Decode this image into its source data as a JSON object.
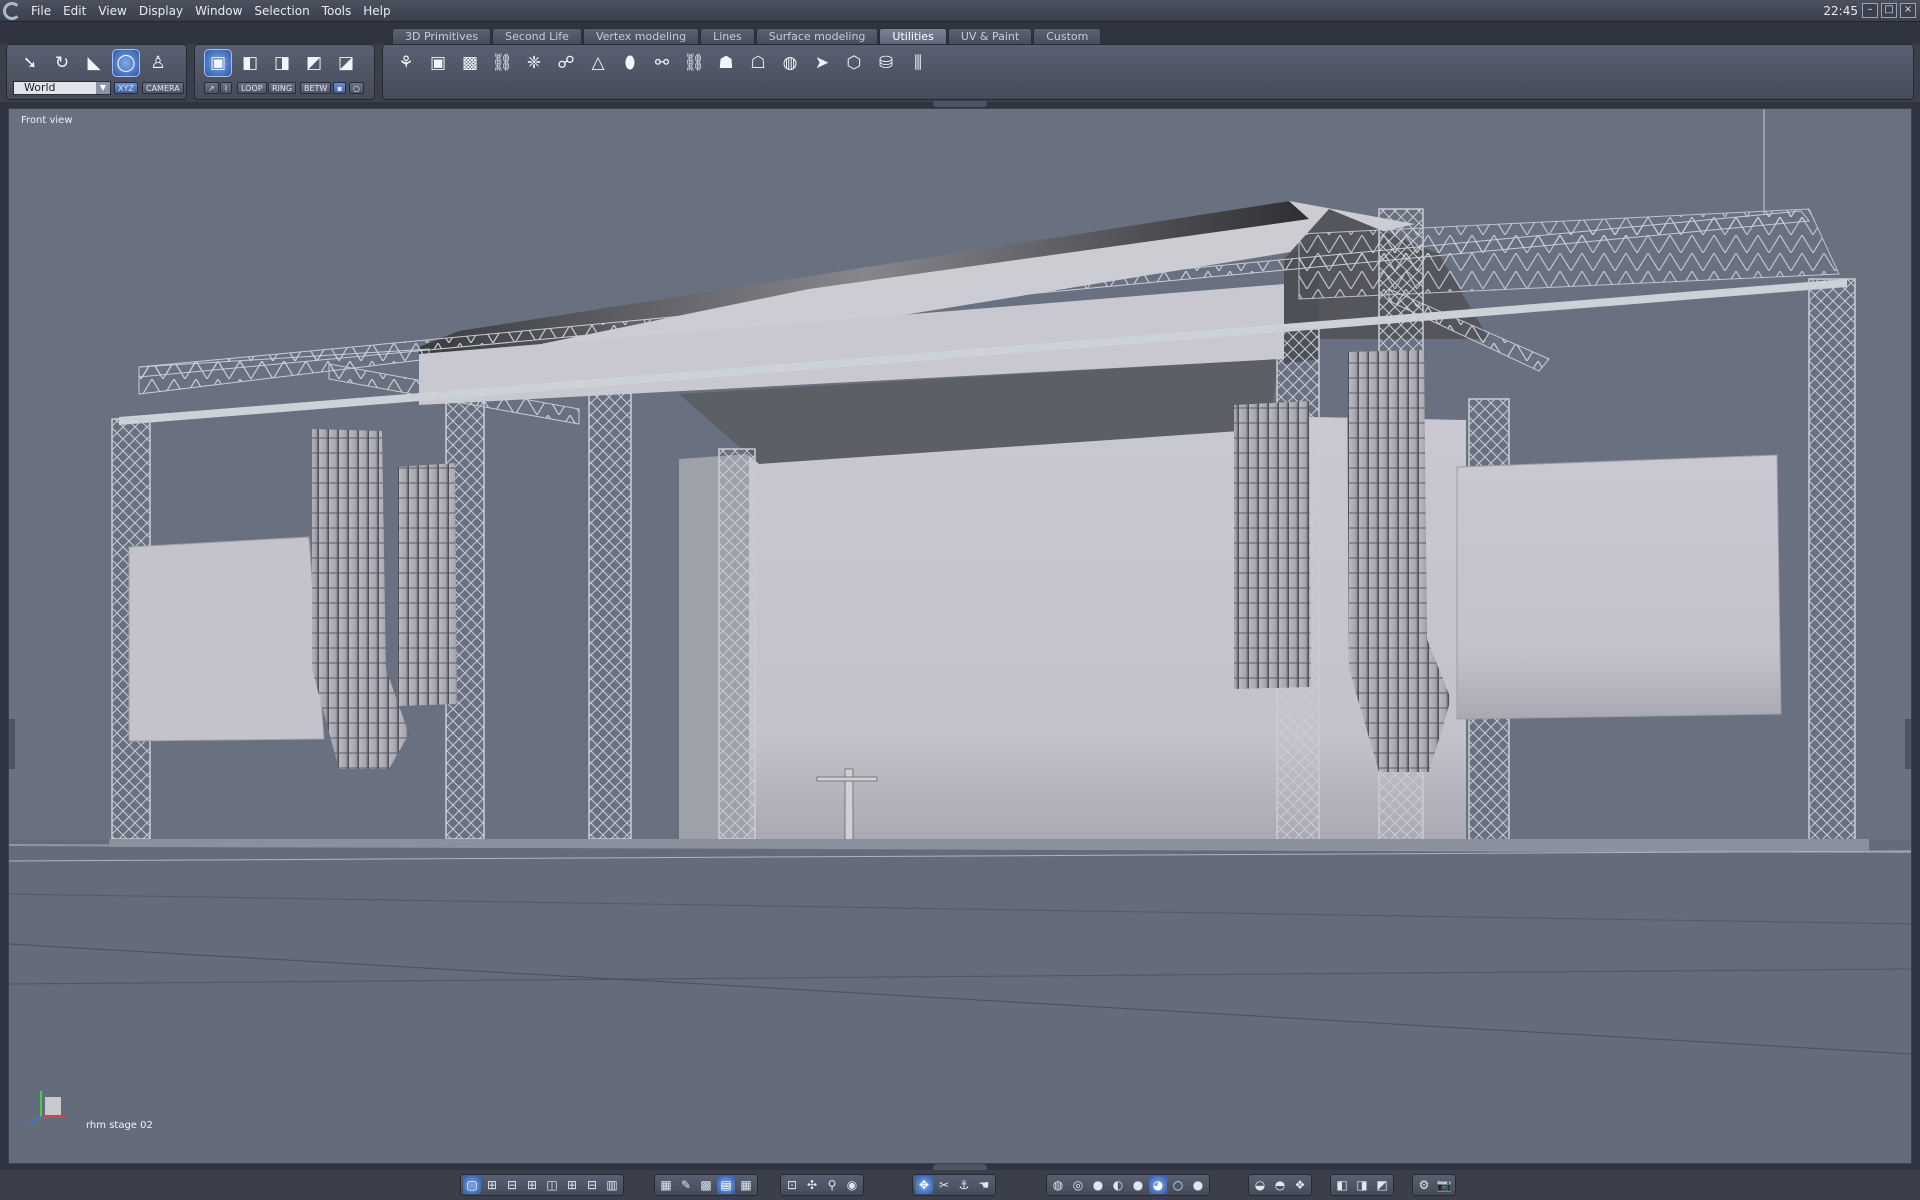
{
  "menu": {
    "items": [
      {
        "id": "file",
        "label": "File"
      },
      {
        "id": "edit",
        "label": "Edit"
      },
      {
        "id": "view",
        "label": "View"
      },
      {
        "id": "display",
        "label": "Display"
      },
      {
        "id": "window",
        "label": "Window"
      },
      {
        "id": "selection",
        "label": "Selection"
      },
      {
        "id": "tools",
        "label": "Tools"
      },
      {
        "id": "help",
        "label": "Help"
      }
    ],
    "clock": "22:45"
  },
  "tabs": [
    {
      "id": "3d-primitives",
      "label": "3D Primitives",
      "active": false
    },
    {
      "id": "second-life",
      "label": "Second Life",
      "active": false
    },
    {
      "id": "vertex-modeling",
      "label": "Vertex modeling",
      "active": false
    },
    {
      "id": "lines",
      "label": "Lines",
      "active": false
    },
    {
      "id": "surface-modeling",
      "label": "Surface modeling",
      "active": false
    },
    {
      "id": "utilities",
      "label": "Utilities",
      "active": true
    },
    {
      "id": "uv-paint",
      "label": "UV & Paint",
      "active": false
    },
    {
      "id": "custom",
      "label": "Custom",
      "active": false
    }
  ],
  "transform_panel": {
    "coordinate_space": "World",
    "xyz_label": "XYZ",
    "camera_label": "CAMERA"
  },
  "selection_panel": {
    "loop_label": "LOOP",
    "ring_label": "RING",
    "betw_label": "BETW"
  },
  "viewport": {
    "label": "Front view",
    "object_name": "rhm stage 02",
    "background": "#69707f"
  },
  "utility_icons": [
    "cloth-icon",
    "box-icon",
    "cube-grid-icon",
    "chain-icon",
    "molecule-icon",
    "links-icon",
    "cone-icon",
    "capsule-icon",
    "link-icon",
    "chain-link-icon",
    "ghost-icon",
    "ghost-outline-icon",
    "globe-icon",
    "arrow-icon",
    "polygon-icon",
    "cylinder-icon",
    "grass-icon"
  ],
  "colors": {
    "accent": "#3b6bc4",
    "panel": "#4f5564",
    "viewport": "#69707f"
  }
}
